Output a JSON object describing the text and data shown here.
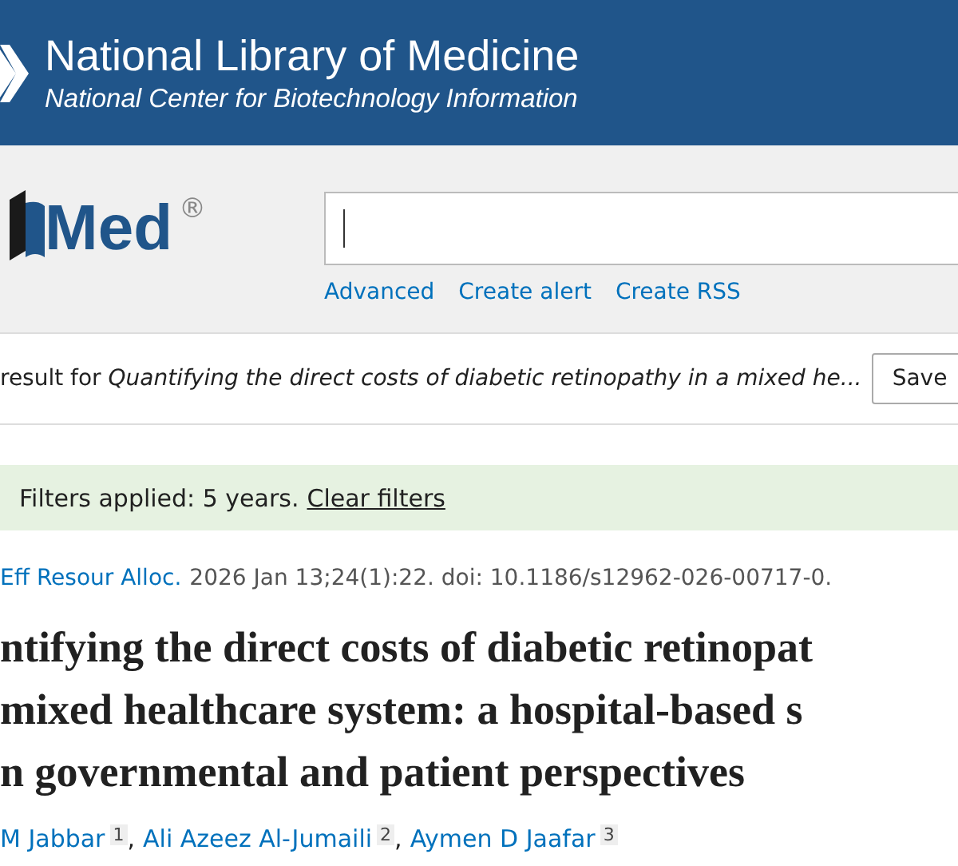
{
  "header": {
    "title": "National Library of Medicine",
    "subtitle": "National Center for Biotechnology Information"
  },
  "logo": {
    "text": "Med",
    "mark": "®"
  },
  "search": {
    "links": [
      "Advanced",
      "Create alert",
      "Create RSS"
    ]
  },
  "result": {
    "prefix": "result for",
    "query": "Quantifying the direct costs of diabetic retinopathy in a mixed he...",
    "save": "Save"
  },
  "filters": {
    "text": "Filters applied: 5 years.",
    "clear": "Clear filters"
  },
  "citation": {
    "journal": "Eff Resour Alloc.",
    "details": "2026 Jan 13;24(1):22. doi: 10.1186/s12962-026-00717-0."
  },
  "title_lines": [
    "ntifying the direct costs of diabetic retinopat",
    "mixed healthcare system: a hospital-based s",
    "n governmental and patient perspectives"
  ],
  "authors": [
    {
      "name": "M Jabbar",
      "affiliation": "1",
      "separator": ","
    },
    {
      "name": "Ali Azeez Al-Jumaili",
      "affiliation": "2",
      "separator": ","
    },
    {
      "name": "Aymen D Jaafar",
      "affiliation": "3"
    }
  ]
}
